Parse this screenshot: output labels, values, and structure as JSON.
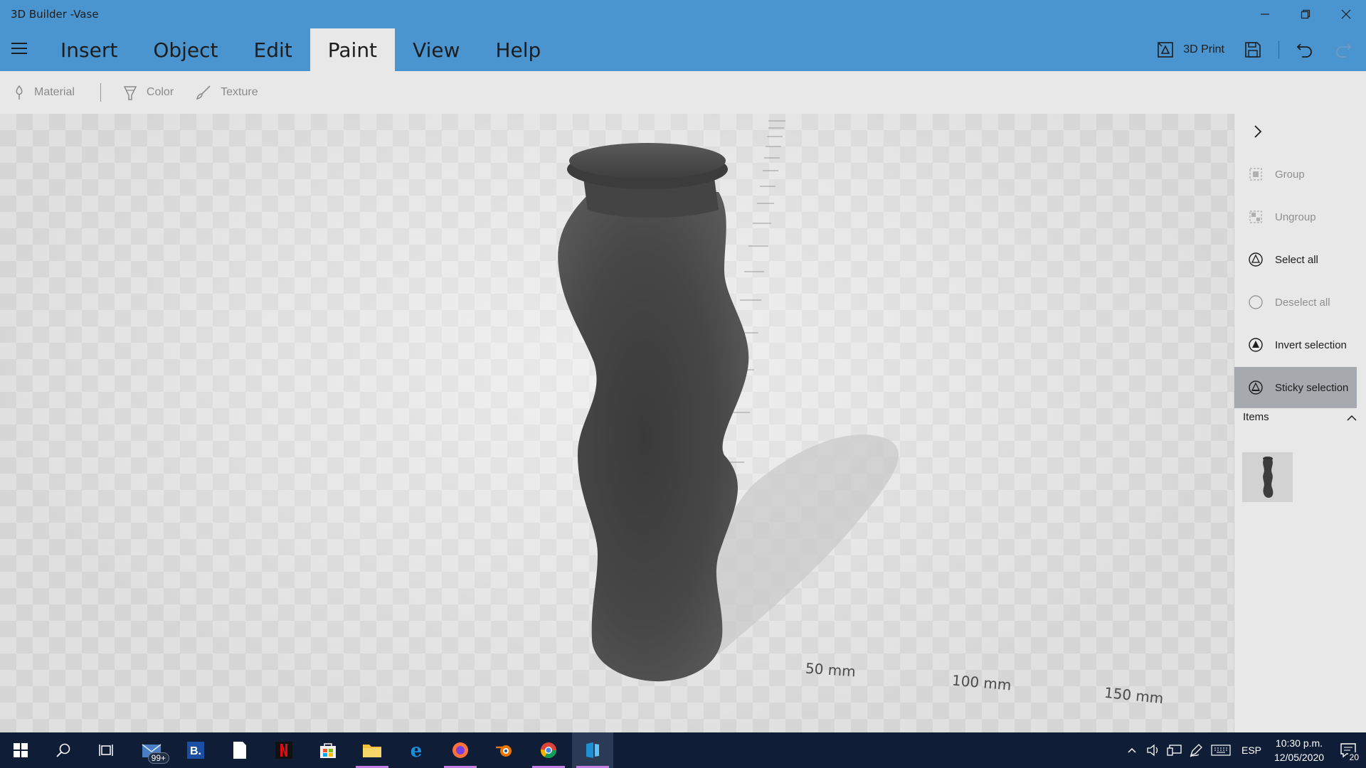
{
  "window": {
    "title": "3D Builder -Vase",
    "controls": [
      "minimize-icon",
      "restore-icon",
      "close-icon"
    ]
  },
  "menu": {
    "tabs": [
      {
        "label": "Insert"
      },
      {
        "label": "Object"
      },
      {
        "label": "Edit"
      },
      {
        "label": "Paint",
        "active": true
      },
      {
        "label": "View"
      },
      {
        "label": "Help"
      }
    ],
    "print_label": "3D Print",
    "icons": [
      "hamburger-icon",
      "print-3d-icon",
      "save-icon",
      "undo-icon",
      "redo-icon"
    ]
  },
  "paint_toolbar": {
    "material_label": "Material",
    "color_label": "Color",
    "texture_label": "Texture"
  },
  "viewport": {
    "ruler_labels": [
      "50 mm",
      "100 mm",
      "150 mm"
    ],
    "object": "Vase"
  },
  "side_panel": {
    "actions": [
      {
        "label": "Group",
        "enabled": false
      },
      {
        "label": "Ungroup",
        "enabled": false
      },
      {
        "label": "Select all",
        "enabled": true
      },
      {
        "label": "Deselect all",
        "enabled": false
      },
      {
        "label": "Invert selection",
        "enabled": true
      },
      {
        "label": "Sticky selection",
        "enabled": true,
        "active": true
      }
    ],
    "items_label": "Items"
  },
  "taskbar": {
    "mail_badge": "99+",
    "language": "ESP",
    "time": "10:30 p.m.",
    "date": "12/05/2020",
    "notification_count": "20",
    "colors": {
      "background": "#0f1d36",
      "running_indicator": "#c37fe0"
    }
  },
  "colors": {
    "title_bar": "#4a95d0",
    "ribbon": "#e8e8e8",
    "active_panel_item": "#a6a9ad"
  }
}
